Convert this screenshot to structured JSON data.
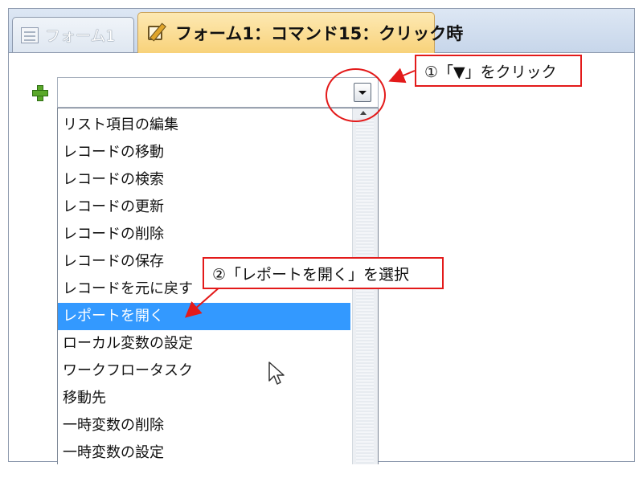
{
  "tabs": [
    {
      "label": "フォーム1",
      "active": false,
      "icon": "form-icon"
    },
    {
      "label": "フォーム1：コマンド15：クリック時",
      "active": true,
      "icon": "macro-icon"
    }
  ],
  "combo": {
    "value": ""
  },
  "action_list": {
    "items": [
      "リスト項目の編集",
      "レコードの移動",
      "レコードの検索",
      "レコードの更新",
      "レコードの削除",
      "レコードの保存",
      "レコードを元に戻す",
      "レポートを開く",
      "ローカル変数の設定",
      "ワークフロータスク",
      "移動先",
      "一時変数の削除",
      "一時変数の設定"
    ],
    "selected": "レポートを開く"
  },
  "annotations": {
    "step1": "①「▼」をクリック",
    "step2": "②「レポートを開く」を選択",
    "color": "#e31a1a"
  },
  "colors": {
    "selection": "#3399ff",
    "active_tab": "#f8d27a",
    "add_icon": "#5aa82a"
  }
}
